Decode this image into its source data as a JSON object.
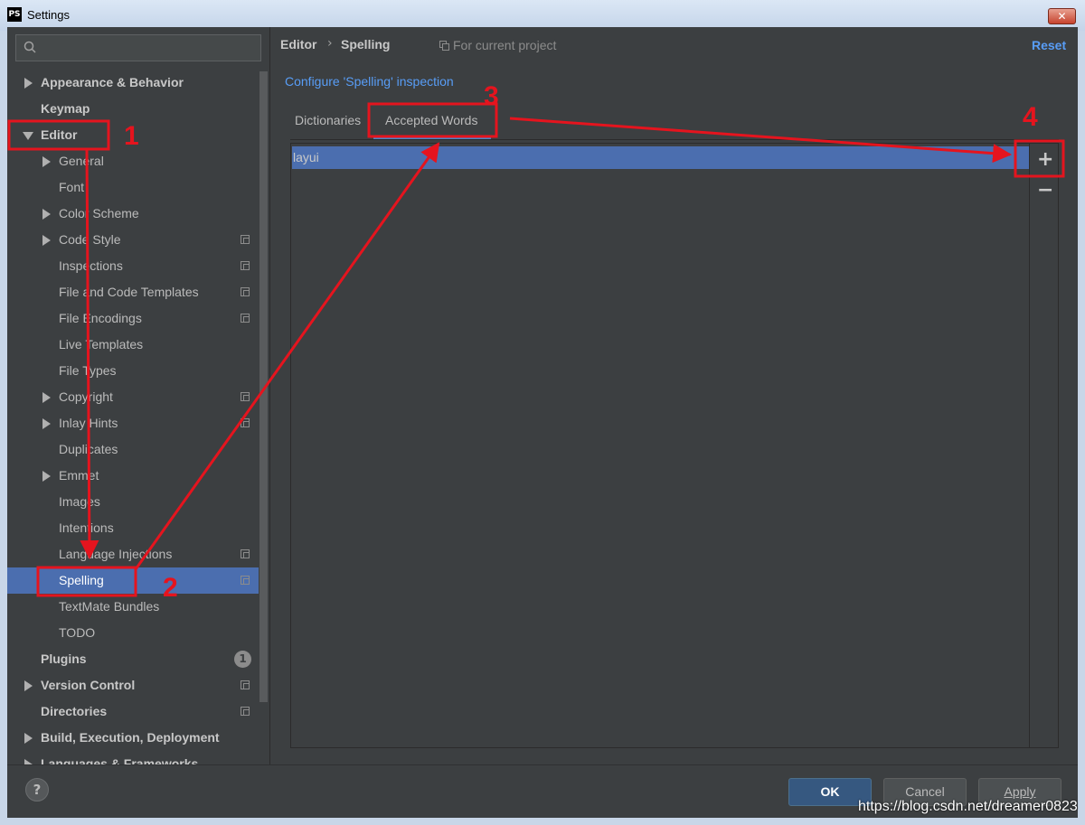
{
  "window": {
    "title": "Settings",
    "app_icon": "PS"
  },
  "sidebar": {
    "search": {
      "placeholder": "",
      "value": ""
    },
    "items": [
      {
        "label": "Appearance & Behavior"
      },
      {
        "label": "Keymap"
      },
      {
        "label": "Editor"
      },
      {
        "label": "General"
      },
      {
        "label": "Font"
      },
      {
        "label": "Color Scheme"
      },
      {
        "label": "Code Style"
      },
      {
        "label": "Inspections"
      },
      {
        "label": "File and Code Templates"
      },
      {
        "label": "File Encodings"
      },
      {
        "label": "Live Templates"
      },
      {
        "label": "File Types"
      },
      {
        "label": "Copyright"
      },
      {
        "label": "Inlay Hints"
      },
      {
        "label": "Duplicates"
      },
      {
        "label": "Emmet"
      },
      {
        "label": "Images"
      },
      {
        "label": "Intentions"
      },
      {
        "label": "Language Injections"
      },
      {
        "label": "Spelling"
      },
      {
        "label": "TextMate Bundles"
      },
      {
        "label": "TODO"
      },
      {
        "label": "Plugins",
        "badge": "1"
      },
      {
        "label": "Version Control"
      },
      {
        "label": "Directories"
      },
      {
        "label": "Build, Execution, Deployment"
      },
      {
        "label": "Languages & Frameworks"
      }
    ]
  },
  "header": {
    "breadcrumb": [
      "Editor",
      "Spelling"
    ],
    "breadcrumb_separator": "›",
    "scope": "For current project",
    "reset": "Reset"
  },
  "content": {
    "configure_link": "Configure 'Spelling' inspection",
    "tabs": [
      "Dictionaries",
      "Accepted Words"
    ],
    "active_tab": "Accepted Words",
    "words": [
      "layui"
    ],
    "add_button": "+",
    "remove_button": "−"
  },
  "footer": {
    "help": "?",
    "ok": "OK",
    "cancel": "Cancel",
    "apply": "Apply"
  },
  "annotations": {
    "labels": [
      "1",
      "2",
      "3",
      "4"
    ],
    "color": "#e5141e"
  },
  "watermark": "https://blog.csdn.net/dreamer0823",
  "colors": {
    "selection": "#4b6eaf",
    "link": "#589df6",
    "background": "#3c3f41",
    "tab_underline": "#4a88c7"
  }
}
